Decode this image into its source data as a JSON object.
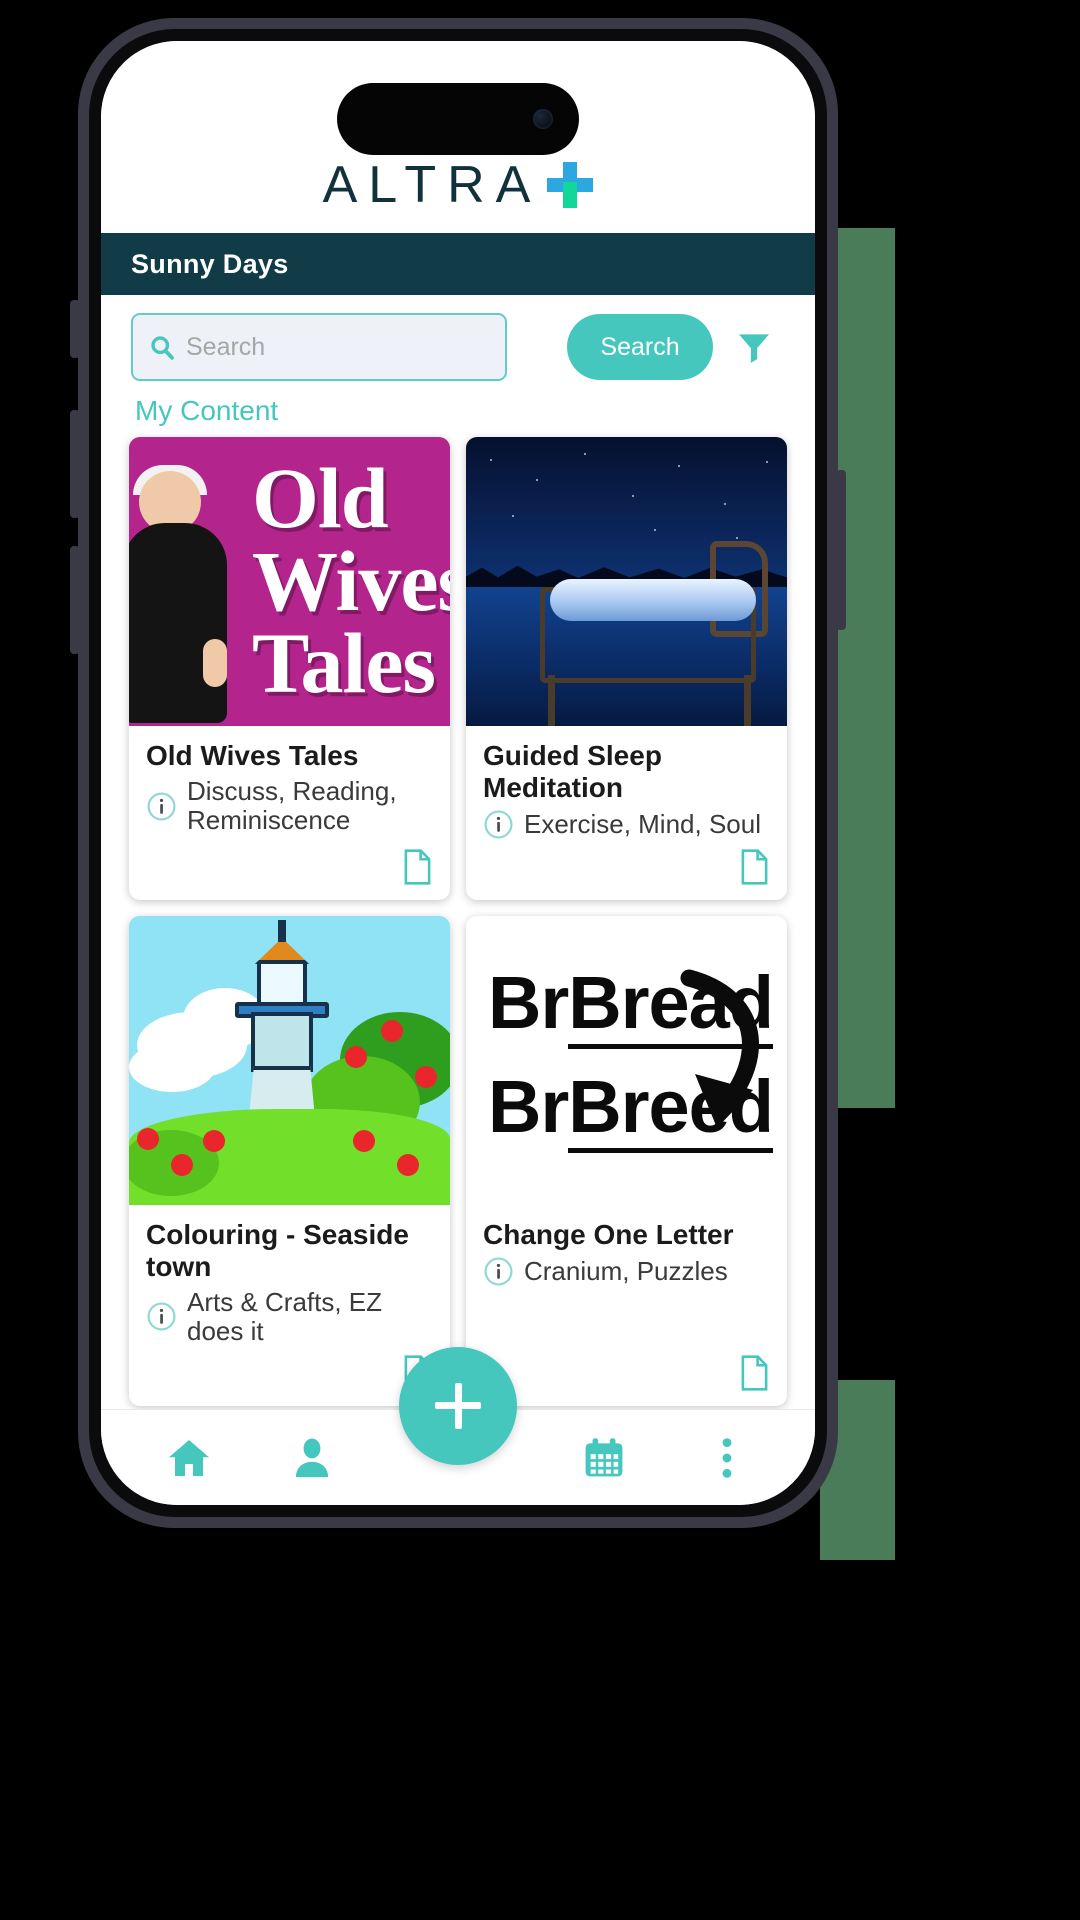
{
  "brand": {
    "word": "ALTRA",
    "plus_icon": "plus-icon"
  },
  "titlebar": {
    "title": "Sunny Days"
  },
  "search": {
    "placeholder": "Search",
    "value": "",
    "button_label": "Search",
    "search_icon": "search-icon",
    "filter_icon": "filter-funnel-icon"
  },
  "my_content_link": "My Content",
  "cards": [
    {
      "title": "Old Wives Tales",
      "tags": "Discuss, Reading, Reminiscence",
      "info_icon": "info-icon",
      "doc_icon": "document-icon",
      "thumb_text_1": "Old",
      "thumb_text_2": "Wives",
      "thumb_text_3": "Tales"
    },
    {
      "title": "Guided Sleep Meditation",
      "tags": "Exercise, Mind, Soul",
      "info_icon": "info-icon",
      "doc_icon": "document-icon"
    },
    {
      "title": "Colouring - Seaside town",
      "tags": "Arts & Crafts, EZ does it",
      "info_icon": "info-icon",
      "doc_icon": "document-icon"
    },
    {
      "title": "Change One Letter",
      "tags": "Cranium, Puzzles",
      "info_icon": "info-icon",
      "doc_icon": "document-icon",
      "thumb_word_1": "Bread",
      "thumb_word_2": "Breed"
    }
  ],
  "navbar": {
    "items": [
      {
        "name": "home-icon"
      },
      {
        "name": "person-icon"
      },
      {
        "name": "calendar-icon"
      },
      {
        "name": "more-vertical-icon"
      }
    ],
    "fab_icon": "plus-icon"
  },
  "colors": {
    "accent_teal": "#45c7bd",
    "header_dark": "#113b46",
    "logo_green": "#12d69a",
    "logo_blue": "#2ba8e0",
    "card_magenta": "#b3248c",
    "sky_blue": "#8fe3f5"
  }
}
